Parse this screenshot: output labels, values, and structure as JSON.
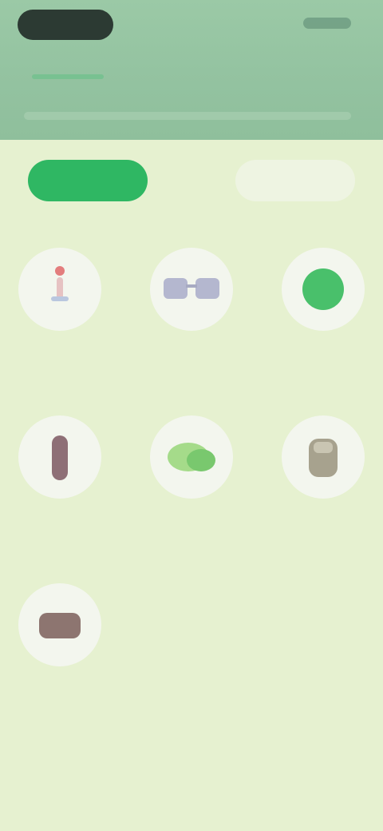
{
  "header": {
    "tabs": [
      {
        "label": "",
        "active": true
      },
      {
        "label": "",
        "active": false
      }
    ]
  },
  "filters": {
    "primary_label": "",
    "secondary_label": ""
  },
  "items": [
    {
      "label": "",
      "icon": "person-icon"
    },
    {
      "label": "",
      "icon": "glasses-icon"
    },
    {
      "label": "",
      "icon": "green-ball-icon"
    },
    {
      "label": "",
      "icon": "bottle-icon"
    },
    {
      "label": "",
      "icon": "leaf-icon"
    },
    {
      "label": "",
      "icon": "bag-icon"
    },
    {
      "label": "",
      "icon": "box-icon"
    }
  ],
  "colors": {
    "accent": "#2fb763",
    "header": "#93c2a0",
    "background": "#e6f1d0"
  }
}
